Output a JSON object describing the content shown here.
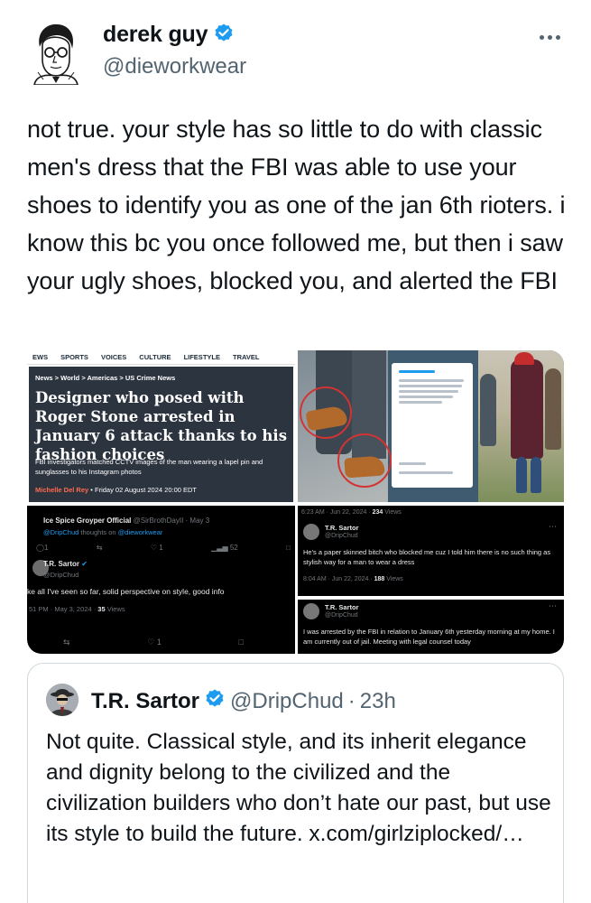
{
  "author": {
    "display_name": "derek guy",
    "handle": "@dieworkwear",
    "avatar_icon": "illustrated-portrait-avatar",
    "verified_icon": "verified-badge-icon"
  },
  "more_icon": "more-options-icon",
  "tweet": {
    "text": "not true. your style has so little to do with classic men's dress that the FBI was able to use your shoes to identify you as one of the jan 6th rioters. i know this bc you once followed me, but then i saw your ugly shoes, blocked you, and alerted the FBI"
  },
  "media": {
    "news": {
      "nav": [
        "EWS",
        "SPORTS",
        "VOICES",
        "CULTURE",
        "LIFESTYLE",
        "TRAVEL"
      ],
      "breadcrumb": "News > World > Americas > US Crime News",
      "headline": "Designer who posed with Roger Stone arrested in January 6 attack thanks to his fashion choices",
      "standfirst": "FBI investigators matched CCTV images of the man wearing a lapel pin and sunglasses to his Instagram photos",
      "author": "Michelle Del Rey",
      "date": "•  Friday 02 August 2024 20:00 EDT"
    },
    "thread": {
      "tweet1_name": "Ice Spice Groyper Official",
      "tweet1_meta": "@SirBrothDayII · May 3",
      "tweet1_sub_handle": "@DripChud",
      "tweet1_sub_text": "thoughts on",
      "tweet1_sub_link": "@dieworkwear",
      "tweet1_views": "52",
      "tweet1_likes": "1",
      "tweet2_name": "T.R. Sartor",
      "tweet2_handle": "@DripChud",
      "tweet2_text": "ke all I've seen so far, solid perspective on style, good info",
      "tweet2_time": "51 PM · May 3, 2024 ·",
      "tweet2_views": "35",
      "tweet2_views_label": "Views",
      "tweet2_likes": "1"
    },
    "reply1": {
      "top_time": "6:23 AM · Jun 22, 2024 ·",
      "top_views": "234",
      "views_label": "Views",
      "name": "T.R. Sartor",
      "handle": "@DripChud",
      "text": "He's a paper skinned bitch who blocked me cuz I told him there is no such thing as stylish way for a man to wear a dress",
      "time": "8:04 AM · Jun 22, 2024 ·",
      "views": "188"
    },
    "reply2": {
      "name": "T.R. Sartor",
      "handle": "@DripChud",
      "text": "I was arrested by the FBI in relation to January 6th yesterday morning at my home. I am currently out of jail. Meeting with legal counsel today"
    }
  },
  "quote": {
    "display_name": "T.R. Sartor",
    "handle": "@DripChud",
    "separator": "·",
    "time": "23h",
    "avatar_icon": "fedora-portrait-avatar",
    "verified_icon": "verified-badge-icon",
    "text": "Not quite. Classical style, and its inherit elegance and dignity belong to the civilized and the civilization builders who don’t hate our past, but use its style to build the future. x.com/girlziplocked/…"
  },
  "colors": {
    "text_primary": "#0f1419",
    "text_secondary": "#536471",
    "verified_blue": "#1d9bf0",
    "border": "#cfd9de"
  }
}
